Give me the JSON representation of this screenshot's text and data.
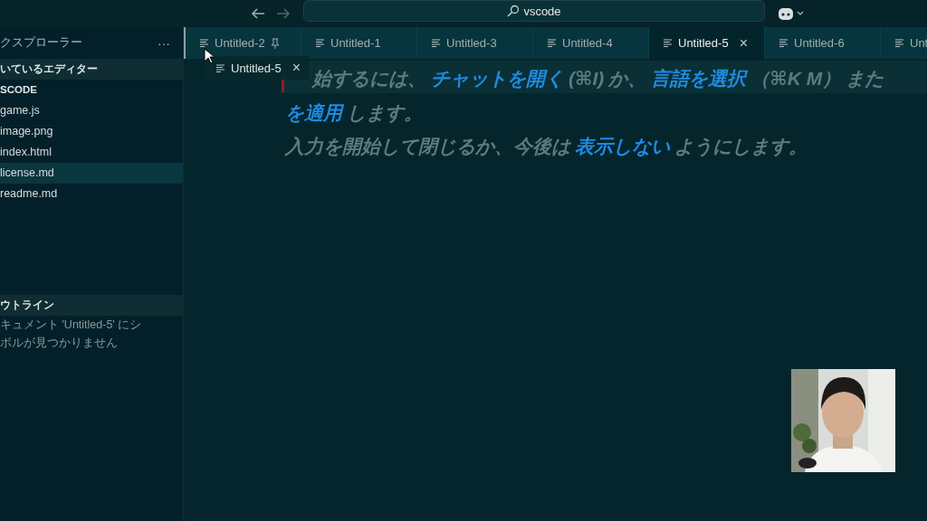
{
  "title_bar": {
    "search": {
      "value": "vscode"
    }
  },
  "sidebar": {
    "title": "クスプローラー",
    "more": "···",
    "open_editors": {
      "label": "いているエディター"
    },
    "folder": {
      "label": "SCODE",
      "files": [
        {
          "name": "game.js",
          "selected": false
        },
        {
          "name": "image.png",
          "selected": false
        },
        {
          "name": "index.html",
          "selected": false
        },
        {
          "name": "license.md",
          "selected": true
        },
        {
          "name": "readme.md",
          "selected": false
        }
      ]
    },
    "outline": {
      "label": "ウトライン",
      "message": [
        "キュメント 'Untitled-5' にシ",
        "ボルが見つかりません"
      ]
    }
  },
  "tabs": [
    {
      "label": "Untitled-2",
      "selected": false,
      "pinned": true
    },
    {
      "label": "Untitled-1",
      "selected": false,
      "pinned": false
    },
    {
      "label": "Untitled-3",
      "selected": false,
      "pinned": false
    },
    {
      "label": "Untitled-4",
      "selected": false,
      "pinned": false
    },
    {
      "label": "Untitled-5",
      "selected": true,
      "pinned": false,
      "close": "×"
    },
    {
      "label": "Untitled-6",
      "selected": false,
      "pinned": false
    },
    {
      "label": "Unt",
      "selected": false,
      "pinned": false
    }
  ],
  "drag_tab": {
    "label": "Untitled-5",
    "close": "×"
  },
  "hint_lines": [
    [
      {
        "kind": "text",
        "text": "始するには、"
      },
      {
        "kind": "link",
        "text": "チャットを開く"
      },
      {
        "kind": "text",
        "text": "(⌘I) "
      },
      {
        "kind": "text",
        "text": "か、"
      },
      {
        "kind": "link",
        "text": "言語を選択"
      },
      {
        "kind": "text",
        "text": "（⌘K M）"
      },
      {
        "kind": "text",
        "text": "また"
      }
    ],
    [
      {
        "kind": "link",
        "text": "を適用"
      },
      {
        "kind": "text",
        "text": "します。"
      }
    ],
    [
      {
        "kind": "text",
        "text": "入力を開始して閉じるか、今後は"
      },
      {
        "kind": "link",
        "text": "表示しない"
      },
      {
        "kind": "text",
        "text": "ようにします。"
      }
    ]
  ],
  "webcam": {
    "kind": "picture"
  }
}
